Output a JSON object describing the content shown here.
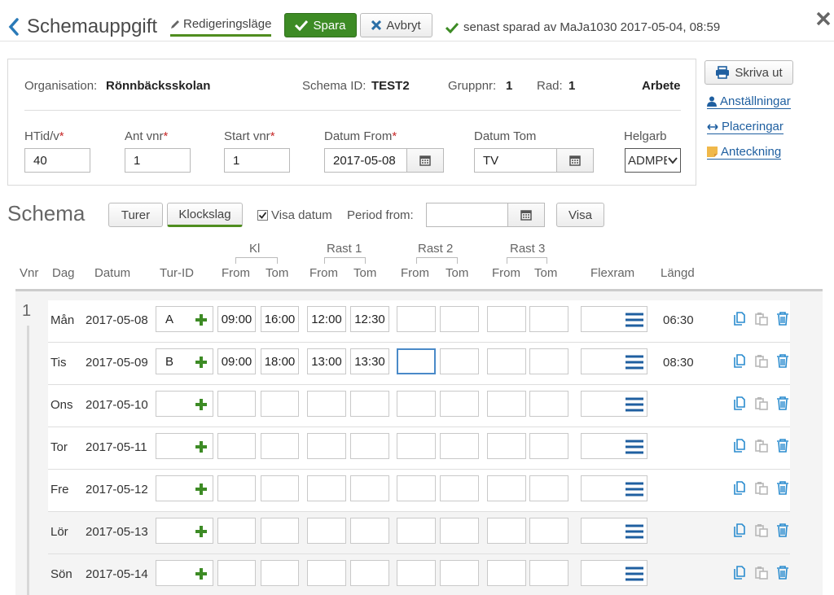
{
  "header": {
    "title": "Schemauppgift",
    "edit_mode": "Redigeringsläge",
    "save": "Spara",
    "cancel": "Avbryt",
    "saved_status": "senast sparad av MaJa1030 2017-05-04, 08:59"
  },
  "info": {
    "org_label": "Organisation:",
    "org_value": "Rönnbäcksskolan",
    "schema_id_label": "Schema ID:",
    "schema_id_value": "TEST2",
    "gruppnr_label": "Gruppnr:",
    "gruppnr_value": "1",
    "rad_label": "Rad:",
    "rad_value": "1",
    "status": "Arbete",
    "fields": {
      "htid_label": "HTid/v",
      "htid_value": "40",
      "antvnr_label": "Ant vnr",
      "antvnr_value": "1",
      "startvnr_label": "Start vnr",
      "startvnr_value": "1",
      "datum_from_label": "Datum From",
      "datum_from_value": "2017-05-08",
      "datum_tom_label": "Datum Tom",
      "datum_tom_value": "TV",
      "helgarb_label": "Helgarb",
      "helgarb_value": "ADMPE"
    },
    "required_mark": "*"
  },
  "side": {
    "print": "Skriva ut",
    "installningar": "Anställningar",
    "placeringar": "Placeringar",
    "anteckning": "Anteckning"
  },
  "schema": {
    "title": "Schema",
    "turer": "Turer",
    "klockslag": "Klockslag",
    "visa_datum": "Visa datum",
    "visa_datum_checked": true,
    "period_from_label": "Period from:",
    "period_from_value": "",
    "visa": "Visa"
  },
  "columns": {
    "vnr": "Vnr",
    "dag": "Dag",
    "datum": "Datum",
    "tur_id": "Tur-ID",
    "kl": "Kl",
    "rast1": "Rast 1",
    "rast2": "Rast 2",
    "rast3": "Rast 3",
    "from": "From",
    "tom": "Tom",
    "flexram": "Flexram",
    "langd": "Längd"
  },
  "week_number": "1",
  "rows": [
    {
      "dag": "Mån",
      "datum": "2017-05-08",
      "tur": "A",
      "kl_from": "09:00",
      "kl_tom": "16:00",
      "r1_from": "12:00",
      "r1_tom": "12:30",
      "r2_from": "",
      "r2_tom": "",
      "r3_from": "",
      "r3_tom": "",
      "langd": "06:30"
    },
    {
      "dag": "Tis",
      "datum": "2017-05-09",
      "tur": "B",
      "kl_from": "09:00",
      "kl_tom": "18:00",
      "r1_from": "13:00",
      "r1_tom": "13:30",
      "r2_from": "",
      "r2_tom": "",
      "r3_from": "",
      "r3_tom": "",
      "langd": "08:30"
    },
    {
      "dag": "Ons",
      "datum": "2017-05-10",
      "tur": "",
      "kl_from": "",
      "kl_tom": "",
      "r1_from": "",
      "r1_tom": "",
      "r2_from": "",
      "r2_tom": "",
      "r3_from": "",
      "r3_tom": "",
      "langd": ""
    },
    {
      "dag": "Tor",
      "datum": "2017-05-11",
      "tur": "",
      "kl_from": "",
      "kl_tom": "",
      "r1_from": "",
      "r1_tom": "",
      "r2_from": "",
      "r2_tom": "",
      "r3_from": "",
      "r3_tom": "",
      "langd": ""
    },
    {
      "dag": "Fre",
      "datum": "2017-05-12",
      "tur": "",
      "kl_from": "",
      "kl_tom": "",
      "r1_from": "",
      "r1_tom": "",
      "r2_from": "",
      "r2_tom": "",
      "r3_from": "",
      "r3_tom": "",
      "langd": ""
    },
    {
      "dag": "Lör",
      "datum": "2017-05-13",
      "tur": "",
      "kl_from": "",
      "kl_tom": "",
      "r1_from": "",
      "r1_tom": "",
      "r2_from": "",
      "r2_tom": "",
      "r3_from": "",
      "r3_tom": "",
      "langd": ""
    },
    {
      "dag": "Sön",
      "datum": "2017-05-14",
      "tur": "",
      "kl_from": "",
      "kl_tom": "",
      "r1_from": "",
      "r1_tom": "",
      "r2_from": "",
      "r2_tom": "",
      "r3_from": "",
      "r3_tom": "",
      "langd": ""
    }
  ],
  "colors": {
    "accent_green": "#3d8b25",
    "link_blue": "#1f5fa0",
    "icon_blue": "#2a8ccf",
    "required_red": "#c62828"
  },
  "icons": {
    "back": "chevron-left-icon",
    "edit": "pencil-icon",
    "save": "checkmark-icon",
    "cancel": "x-icon",
    "saved": "checkmark-icon",
    "close": "close-icon",
    "print": "printer-icon",
    "calendar": "calendar-icon",
    "person": "person-icon",
    "arrows": "horizontal-arrows-icon",
    "note": "note-icon",
    "add": "plus-icon",
    "menu": "hamburger-icon",
    "copy": "copy-icon",
    "paste": "paste-icon",
    "delete": "trash-icon"
  }
}
